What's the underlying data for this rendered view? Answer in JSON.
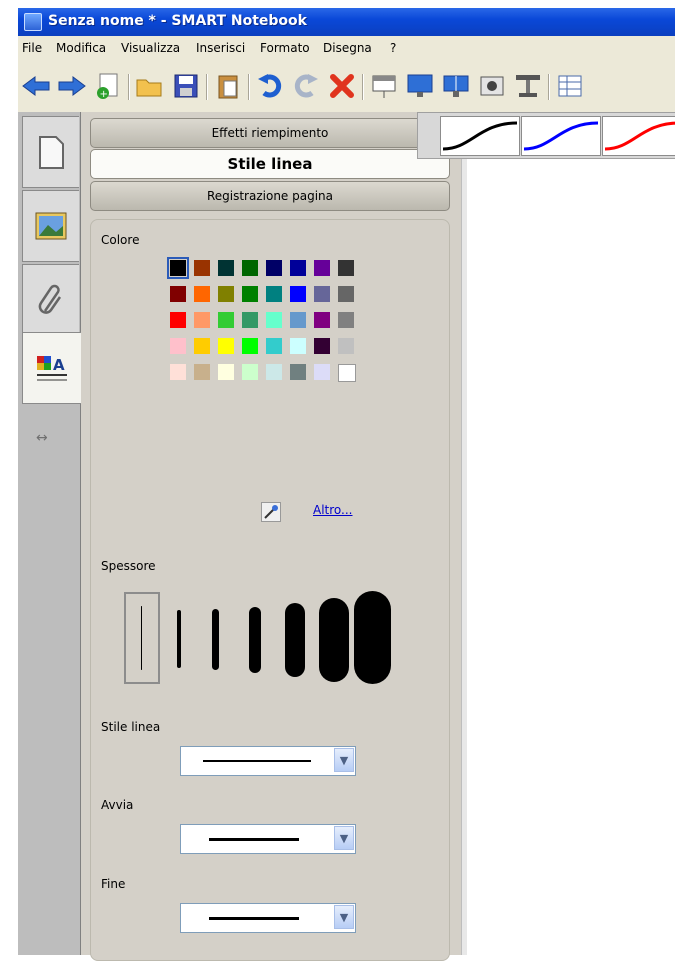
{
  "window": {
    "title": "Senza nome * - SMART Notebook"
  },
  "menu": {
    "items": [
      "File",
      "Modifica",
      "Visualizza",
      "Inserisci",
      "Formato",
      "Disegna",
      "?"
    ]
  },
  "toolbar": {
    "buttons": [
      "back-arrow-icon",
      "forward-arrow-icon",
      "new-page-icon",
      "open-folder-icon",
      "save-icon",
      "paste-icon",
      "undo-icon",
      "redo-icon",
      "delete-icon",
      "screen-shade-icon",
      "display-icon",
      "dual-display-icon",
      "camera-icon",
      "document-camera-icon",
      "table-icon"
    ]
  },
  "side_tabs": [
    "page-sorter-icon",
    "gallery-icon",
    "attachments-icon",
    "properties-icon"
  ],
  "panel": {
    "headers": {
      "fill_effects": "Effetti riempimento",
      "line_style": "Stile linea",
      "page_recording": "Registrazione pagina"
    },
    "color_label": "Colore",
    "more_link": "Altro...",
    "thickness_label": "Spessore",
    "line_style_label": "Stile linea",
    "start_label": "Avvia",
    "end_label": "Fine"
  },
  "palette": [
    [
      "#000000",
      "#993300",
      "#003333",
      "#006600",
      "#000066",
      "#000099",
      "#660099",
      "#333333"
    ],
    [
      "#800000",
      "#ff6600",
      "#808000",
      "#008000",
      "#008080",
      "#0000ff",
      "#666699",
      "#666666"
    ],
    [
      "#ff0000",
      "#ff9966",
      "#33cc33",
      "#339966",
      "#66ffcc",
      "#6699cc",
      "#800080",
      "#808080"
    ],
    [
      "#ffc0cb",
      "#ffcc00",
      "#ffff00",
      "#00ff00",
      "#33cccc",
      "#ccffff",
      "#330033",
      "#c0c0c0"
    ],
    [
      "#ffe0d8",
      "#c8b08c",
      "#ffffe0",
      "#ccffcc",
      "#cce8e8",
      "#708080",
      "#dcdcf8",
      "#ffffff"
    ]
  ],
  "selected_color": "#000000",
  "line_presets": [
    "#000000",
    "#0000ff",
    "#ff0000"
  ]
}
